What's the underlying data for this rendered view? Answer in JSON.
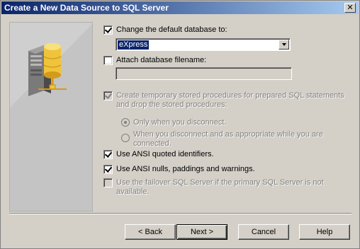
{
  "window": {
    "title": "Create a New Data Source to SQL Server",
    "close_glyph": "✕"
  },
  "icons": {
    "wizard_image": "database-server-network-icon",
    "close": "close-icon",
    "dropdown": "chevron-down-icon"
  },
  "options": {
    "change_default_db": {
      "label": "Change the default database to:",
      "checked": true
    },
    "default_db_value": "eXpress",
    "attach_db_filename": {
      "label": "Attach database filename:",
      "checked": false
    },
    "attach_filename_value": "",
    "create_temp_procs": {
      "label": "Create temporary stored procedures for prepared SQL statements and drop the stored procedures:",
      "checked": true,
      "disabled": true
    },
    "radio_only_disconnect": {
      "label": "Only when you disconnect.",
      "selected": true,
      "disabled": true
    },
    "radio_disconnect_and_appropriate": {
      "label": "When you disconnect and as appropriate while you are connected.",
      "selected": false,
      "disabled": true
    },
    "ansi_quoted": {
      "label": "Use ANSI quoted identifiers.",
      "checked": true
    },
    "ansi_nulls": {
      "label": "Use ANSI nulls, paddings and warnings.",
      "checked": true
    },
    "failover": {
      "label": "Use the failover SQL Server if the primary SQL Server is not available.",
      "checked": false,
      "disabled": true
    }
  },
  "buttons": {
    "back": "< Back",
    "next": "Next >",
    "cancel": "Cancel",
    "help": "Help"
  },
  "colors": {
    "titlebar_start": "#0a246a",
    "titlebar_end": "#a6caf0",
    "dialog_face": "#d4d0c8",
    "selection": "#0a246a"
  }
}
